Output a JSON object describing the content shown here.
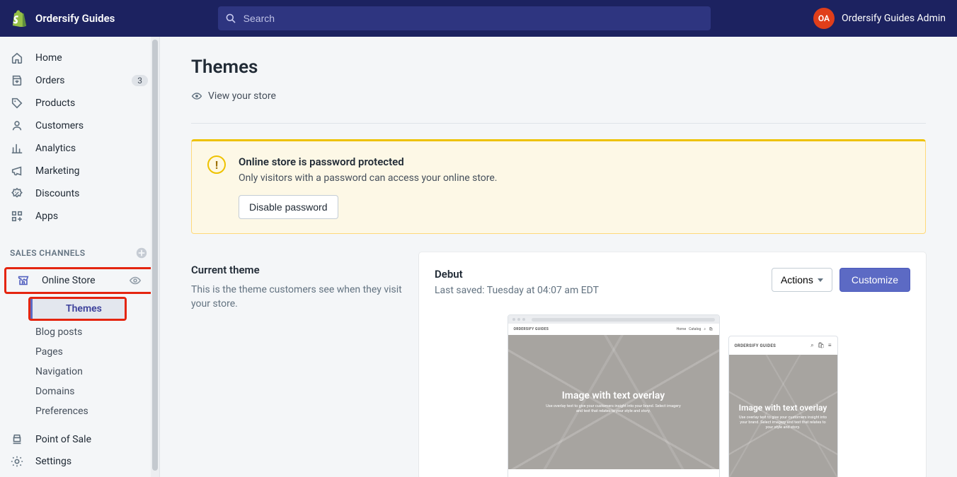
{
  "header": {
    "brand": "Ordersify Guides",
    "search_placeholder": "Search",
    "avatar_initials": "OA",
    "user_label": "Ordersify Guides Admin"
  },
  "sidebar": {
    "items": [
      {
        "label": "Home",
        "icon": "home"
      },
      {
        "label": "Orders",
        "icon": "orders",
        "badge": "3"
      },
      {
        "label": "Products",
        "icon": "products"
      },
      {
        "label": "Customers",
        "icon": "customers"
      },
      {
        "label": "Analytics",
        "icon": "analytics"
      },
      {
        "label": "Marketing",
        "icon": "marketing"
      },
      {
        "label": "Discounts",
        "icon": "discounts"
      },
      {
        "label": "Apps",
        "icon": "apps"
      }
    ],
    "section_label": "SALES CHANNELS",
    "channel": {
      "label": "Online Store",
      "sub": [
        {
          "label": "Themes",
          "active": true
        },
        {
          "label": "Blog posts"
        },
        {
          "label": "Pages"
        },
        {
          "label": "Navigation"
        },
        {
          "label": "Domains"
        },
        {
          "label": "Preferences"
        }
      ]
    },
    "pos_label": "Point of Sale",
    "settings_label": "Settings"
  },
  "page": {
    "title": "Themes",
    "view_store": "View your store"
  },
  "banner": {
    "title": "Online store is password protected",
    "text": "Only visitors with a password can access your online store.",
    "button": "Disable password"
  },
  "current": {
    "heading": "Current theme",
    "desc": "This is the theme customers see when they visit your store."
  },
  "theme": {
    "name": "Debut",
    "saved": "Last saved: Tuesday at 04:07 am EDT",
    "actions_label": "Actions",
    "customize_label": "Customize"
  },
  "preview": {
    "store_name": "ORDERSIFY GUIDES",
    "nav1": "Home",
    "nav2": "Catalog",
    "hero_title": "Image with text overlay",
    "hero_sub_desktop": "Use overlay text to give your customers insight into your brand. Select imagery and text that relates to your style and story.",
    "hero_sub_mobile": "Use overlay text to give your customers insight into your brand. Select imagery and text that relates to your style and story."
  }
}
